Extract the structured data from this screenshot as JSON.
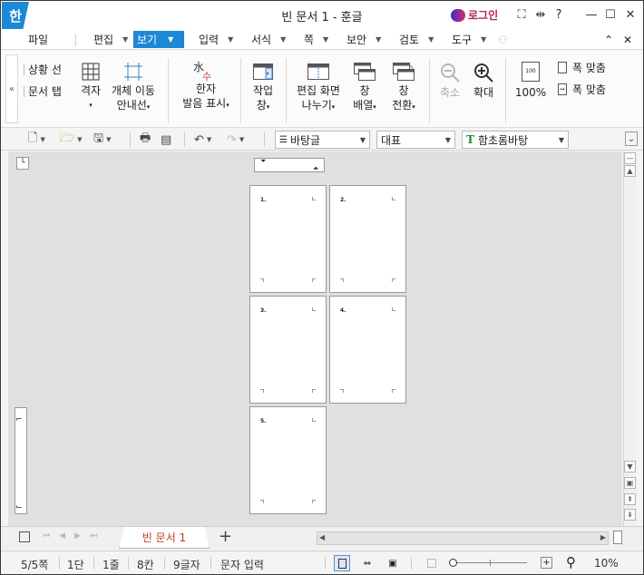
{
  "app": {
    "logo": "한",
    "title": "빈 문서 1 - 훈글",
    "login_label": "로그인"
  },
  "window_controls": {
    "fullscreen_icon": "⛶",
    "split_icon": "⇹",
    "help_label": "?",
    "minimize": "—",
    "maximize": "☐",
    "close": "✕"
  },
  "menu": {
    "items": [
      {
        "label": "파일"
      },
      {
        "label": "편집"
      },
      {
        "label": "보기"
      },
      {
        "label": "입력"
      },
      {
        "label": "서식"
      },
      {
        "label": "쪽"
      },
      {
        "label": "보안"
      },
      {
        "label": "검토"
      },
      {
        "label": "도구"
      }
    ],
    "collapse_icon": "⌃",
    "close_icon": "✕"
  },
  "ribbon": {
    "collapse_icon": "«",
    "check1": "상황 선",
    "check2": "문서 탭",
    "grid": "격자",
    "grid_caret": "▾",
    "obj_guide_1": "개체 이동",
    "obj_guide_2": "안내선",
    "hanja_icon_top": "水",
    "hanja_icon_bottom": "수",
    "hanja_1": "한자",
    "hanja_2": "발음 표시",
    "workwin_1": "작업",
    "workwin_2": "창",
    "split_1": "편집 화면",
    "split_2": "나누기",
    "arrange_1": "창",
    "arrange_2": "배열",
    "switch_1": "창",
    "switch_2": "전환",
    "zoom_out": "축소",
    "zoom_in": "확대",
    "zoom_100": "100%",
    "zoom_100_icon": "100",
    "fit_width": "폭 맞춤",
    "fit_page": "폭 맞춤"
  },
  "toolbar": {
    "style_combo": "바탕글",
    "para_combo": "대표",
    "font_combo": "함초롬바탕",
    "font_icon": "T",
    "overflow_icon": "⌄"
  },
  "pages": [
    "1.",
    "2.",
    "3.",
    "4.",
    "5."
  ],
  "tabs": {
    "doc_tab": "빈 문서 1",
    "add_tab": "+"
  },
  "status": {
    "page": "5/5쪽",
    "column": "1단",
    "line": "1줄",
    "col": "8칸",
    "chars": "9글자",
    "mode": "문자 입력",
    "zoom": "10%"
  }
}
